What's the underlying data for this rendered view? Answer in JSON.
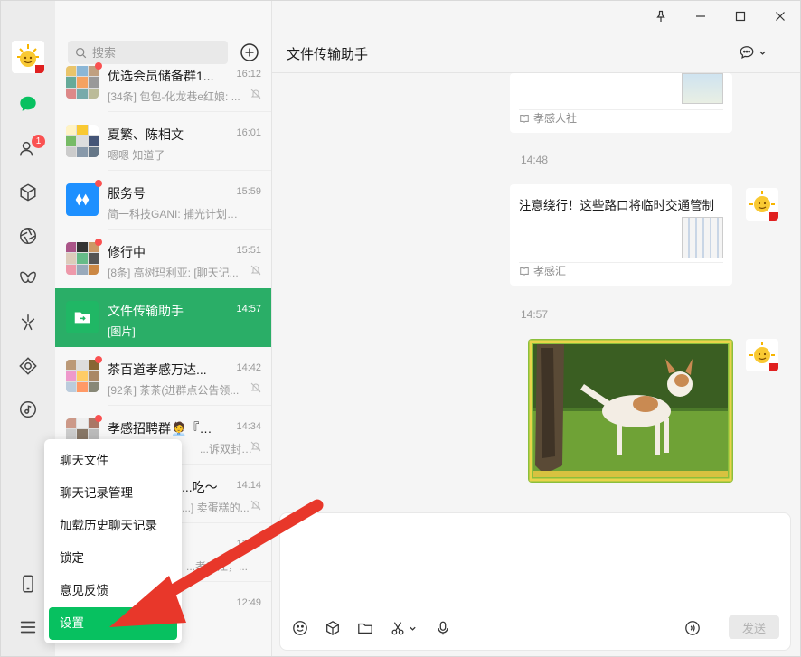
{
  "window": {
    "controls": [
      "pin-icon",
      "minimize-icon",
      "maximize-icon",
      "close-icon"
    ]
  },
  "rail": {
    "contacts_badge": "1",
    "items": [
      "chat-icon",
      "contacts-icon",
      "box-icon",
      "aperture-icon",
      "butterfly-icon",
      "sparkle-icon",
      "diamond-icon",
      "music-icon",
      "phone-icon",
      "menu-icon"
    ],
    "accent": "#07c160"
  },
  "search": {
    "placeholder": "搜索"
  },
  "conversations": [
    {
      "name": "优选会员储备群1...",
      "time": "16:12",
      "preview": "[34条] 包包-化龙巷e红娘: ...",
      "unread": true,
      "muted": true
    },
    {
      "name": "夏繁、陈相文",
      "time": "16:01",
      "preview": "嗯嗯 知道了",
      "unread": false,
      "muted": false
    },
    {
      "name": "服务号",
      "time": "15:59",
      "preview": "简一科技GANI: 捕光计划第二...",
      "unread": true,
      "muted": false
    },
    {
      "name": "修行中",
      "time": "15:51",
      "preview": "[8条] 高树玛利亚: [聊天记...",
      "unread": true,
      "muted": true
    },
    {
      "name": "文件传输助手",
      "time": "14:57",
      "preview": "[图片]",
      "unread": false,
      "muted": false,
      "active": true
    },
    {
      "name": "茶百道孝感万达...",
      "time": "14:42",
      "preview": "[92条] 茶茶(进群点公告领...",
      "unread": true,
      "muted": true
    },
    {
      "name": "孝感招聘群🧑‍💼『掌...",
      "time": "14:34",
      "preview": "...诉双封）: ...",
      "unread": true,
      "muted": true
    },
    {
      "name": "...吃～",
      "time": "14:14",
      "preview": "...] 卖蛋糕的...",
      "unread": false,
      "muted": true
    },
    {
      "name": "",
      "time": "13:44",
      "preview": "...孝感江，...",
      "unread": false,
      "muted": false
    },
    {
      "name": "",
      "time": "12:49",
      "preview": "",
      "unread": false,
      "muted": false
    }
  ],
  "chat": {
    "title": "文件传输助手",
    "messages": [
      {
        "type": "card",
        "source": "孝感人社"
      },
      {
        "type": "time",
        "text": "14:48"
      },
      {
        "type": "card",
        "text": "注意绕行！这些路口将临时交通管制",
        "source": "孝感汇"
      },
      {
        "type": "time",
        "text": "14:57"
      },
      {
        "type": "image",
        "alt": "dog photo"
      }
    ]
  },
  "composer": {
    "send_label": "发送",
    "tools": [
      "emoji-icon",
      "box-icon",
      "folder-icon",
      "scissors-icon",
      "mic-icon",
      "voice-input-icon"
    ]
  },
  "menu": {
    "items": [
      "聊天文件",
      "聊天记录管理",
      "加载历史聊天记录",
      "锁定",
      "意见反馈",
      "设置"
    ],
    "highlight_index": 5,
    "highlight_color": "#07c160"
  },
  "annotation": {
    "arrow_color": "#e8372a"
  }
}
